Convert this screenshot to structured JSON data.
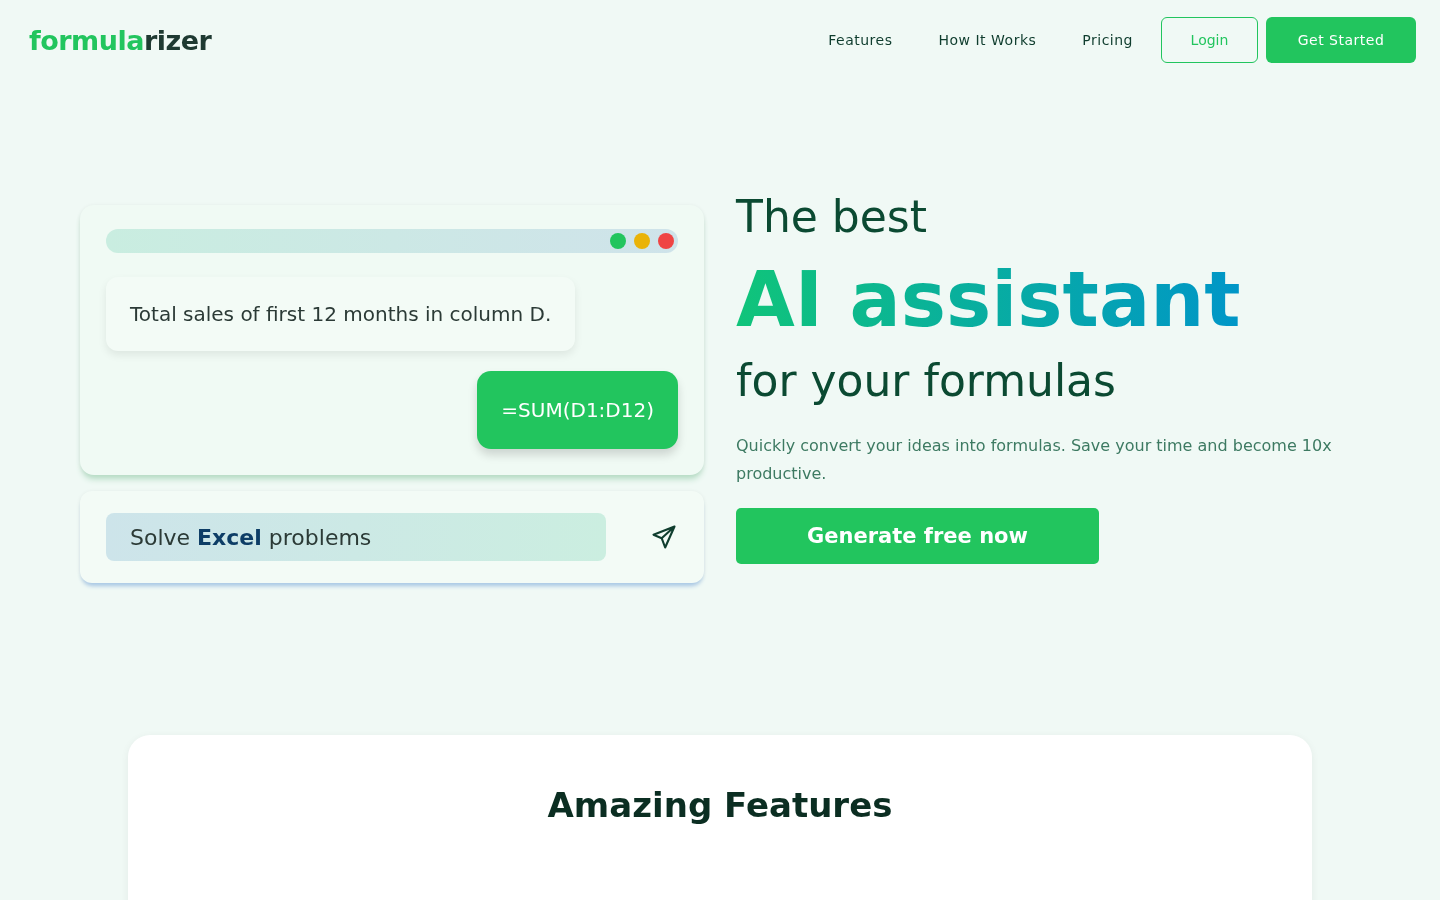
{
  "logo": {
    "primary": "formula",
    "secondary": "rizer"
  },
  "nav": {
    "links": [
      {
        "label": "Features"
      },
      {
        "label": "How It Works"
      },
      {
        "label": "Pricing"
      }
    ],
    "login": "Login",
    "cta": "Get Started"
  },
  "demo": {
    "dots": [
      {
        "color": "#22c55e"
      },
      {
        "color": "#eab308"
      },
      {
        "color": "#ef4444"
      }
    ],
    "prompt": "Total sales of first 12 months in column D.",
    "formula": "=SUM(D1:D12)",
    "input_value": "Solve **Excel** problems"
  },
  "hero": {
    "line_1": "The best",
    "highlight": "AI assistant",
    "line_3": "for your formulas",
    "description": "Quickly convert your ideas into formulas. Save your time and become 10x productive.",
    "button": "Generate free now"
  },
  "features": {
    "title": "Amazing Features"
  }
}
